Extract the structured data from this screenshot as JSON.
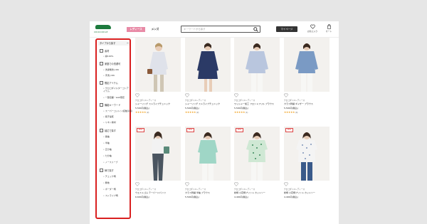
{
  "header": {
    "brand": "CROCODILE",
    "tabs": [
      "レディース",
      "メンズ"
    ],
    "search_placeholder": "キーワードから探す",
    "mypage": "マイページ",
    "favorites_label": "お気に入り",
    "cart_label": "カート"
  },
  "sidebar": {
    "title": "タイプから探す",
    "close": "−",
    "categories": [
      {
        "label": "素材",
        "items": [
          "綿100%"
        ]
      },
      {
        "label": "家庭での洗濯可",
        "items": [
          "洗濯機洗いOK",
          "手洗いOK"
        ]
      },
      {
        "label": "限定アイテム",
        "items": [
          "クロコダイルターコンアイテム",
          "一部店舗・web限定"
        ]
      },
      {
        "label": "機能キーワード",
        "items": [
          "スーパーコットン(接触冷感)",
          "吸汗速乾",
          "リネン素材"
        ]
      },
      {
        "label": "袖丈で探す",
        "items": [
          "長袖",
          "半袖",
          "五分袖",
          "七分袖",
          "ノースリーブ"
        ]
      },
      {
        "label": "柄で探す",
        "items": [
          "チェック柄",
          "無地",
          "ボーダー柄",
          "ストライプ柄"
        ]
      }
    ]
  },
  "products": [
    {
      "brand": "クロコダイルレディース",
      "name": "シャーリング ストライプチュニック",
      "price": "5,500円(税込)",
      "rating": 4,
      "reviews": "(2)",
      "new": false
    },
    {
      "brand": "クロコダイルレディース",
      "name": "シャーリング ストライプチュニック",
      "price": "5,500円(税込)",
      "rating": 4,
      "reviews": "(2)",
      "new": false
    },
    {
      "brand": "クロコダイルレディース",
      "name": "ワッシャー加工 フロントフリル ブラウス",
      "price": "5,500円(税込)",
      "rating": 4,
      "reviews": "(1)",
      "new": false
    },
    {
      "brand": "クロコダイルレディース",
      "name": "カラス刺繍 ギャザー ブラウス",
      "price": "5,500円(税込)",
      "rating": 4,
      "reviews": "(4)",
      "new": false
    },
    {
      "brand": "クロコダイルレディース",
      "name": "ウエストゴム テーパードパンツ",
      "price": "6,600円(税込)",
      "rating": 0,
      "reviews": "",
      "new": true
    },
    {
      "brand": "クロコダイルレディース",
      "name": "カラス刺繍 半袖 ブラウス",
      "price": "5,500円(税込)",
      "rating": 0,
      "reviews": "",
      "new": true
    },
    {
      "brand": "クロコダイルレディース",
      "name": "総柄 小花柄プリント カットソー",
      "price": "4,400円(税込)",
      "rating": 0,
      "reviews": "",
      "new": true
    },
    {
      "brand": "クロコダイルレディース",
      "name": "総柄 小花柄プリント カットソー",
      "price": "4,400円(税込)",
      "rating": 0,
      "reviews": "",
      "new": true
    }
  ],
  "new_badge": "NEW",
  "colors": {
    "accent_pink": "#e88aa6",
    "highlight_red": "#d92020",
    "star": "#f0a020",
    "brand_green": "#1d7a3d"
  }
}
